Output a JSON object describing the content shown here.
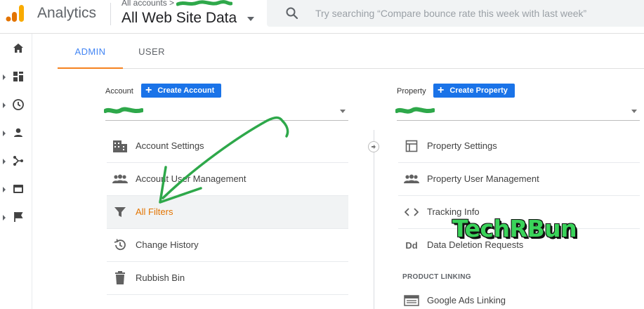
{
  "header": {
    "app_title": "Analytics",
    "account_crumb": "All accounts >",
    "view_title": "All Web Site Data",
    "search_placeholder": "Try searching “Compare bounce rate this week with last week”"
  },
  "tabs": [
    {
      "label": "ADMIN",
      "active": true
    },
    {
      "label": "USER",
      "active": false
    }
  ],
  "account": {
    "label": "Account",
    "create_label": "Create Account",
    "items": [
      {
        "label": "Account Settings",
        "icon": "building-icon"
      },
      {
        "label": "Account User Management",
        "icon": "people-icon"
      },
      {
        "label": "All Filters",
        "icon": "filter-icon",
        "active": true
      },
      {
        "label": "Change History",
        "icon": "history-icon"
      },
      {
        "label": "Rubbish Bin",
        "icon": "trash-icon"
      }
    ]
  },
  "property": {
    "label": "Property",
    "create_label": "Create Property",
    "items": [
      {
        "label": "Property Settings",
        "icon": "window-icon"
      },
      {
        "label": "Property User Management",
        "icon": "people-icon"
      },
      {
        "label": "Tracking Info",
        "icon": "code-icon"
      },
      {
        "label": "Data Deletion Requests",
        "icon": "dd-icon",
        "icon_text": "Dd"
      }
    ],
    "section_product_linking": "PRODUCT LINKING",
    "linking_items": [
      {
        "label": "Google Ads Linking",
        "icon": "ads-icon"
      }
    ]
  },
  "watermark": "TechRBun",
  "colors": {
    "accent_blue": "#1a73e8",
    "tab_underline": "#f58220",
    "active_item": "#e37400",
    "annotation_green": "#2ea84a"
  }
}
